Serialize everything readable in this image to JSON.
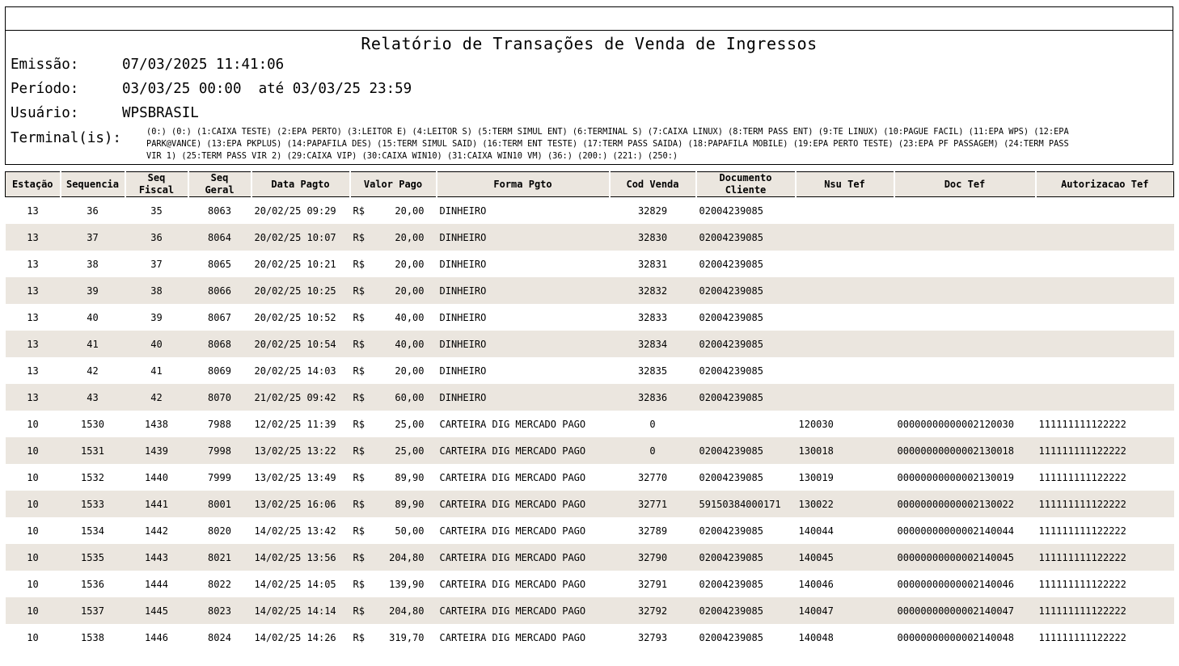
{
  "report": {
    "title": "Relatório de Transações de Venda de Ingressos",
    "emissao_label": "Emissão:",
    "emissao_value": "07/03/2025 11:41:06",
    "periodo_label": "Período:",
    "periodo_value": "03/03/25 00:00  até 03/03/25 23:59",
    "usuario_label": "Usuário:",
    "usuario_value": "WPSBRASIL",
    "terminais_label": "Terminal(is):",
    "terminais_value": "(0:) (0:) (1:CAIXA TESTE) (2:EPA PERTO) (3:LEITOR E) (4:LEITOR S) (5:TERM SIMUL ENT) (6:TERMINAL S) (7:CAIXA LINUX) (8:TERM PASS ENT) (9:TE LINUX) (10:PAGUE FACIL) (11:EPA WPS) (12:EPA PARK@VANCE) (13:EPA PKPLUS) (14:PAPAFILA DES) (15:TERM SIMUL SAID) (16:TERM ENT TESTE) (17:TERM PASS SAIDA) (18:PAPAFILA MOBILE) (19:EPA PERTO TESTE) (23:EPA PF PASSAGEM) (24:TERM PASS VIR 1) (25:TERM PASS VIR 2) (29:CAIXA VIP) (30:CAIXA WIN10) (31:CAIXA WIN10 VM) (36:) (200:) (221:) (250:)"
  },
  "table": {
    "headers": {
      "estacao": "Estação",
      "sequencia": "Sequencia",
      "seq_fiscal_1": "Seq",
      "seq_fiscal_2": "Fiscal",
      "seq_geral_1": "Seq",
      "seq_geral_2": "Geral",
      "data_pagto": "Data Pagto",
      "valor_pago": "Valor Pago",
      "forma_pgto": "Forma Pgto",
      "cod_venda": "Cod Venda",
      "documento_1": "Documento",
      "documento_2": "Cliente",
      "nsu_tef": "Nsu Tef",
      "doc_tef": "Doc Tef",
      "autorizacao_tef": "Autorizacao Tef"
    },
    "rows": [
      {
        "estacao": "13",
        "sequencia": "36",
        "seq_fiscal": "35",
        "seq_geral": "8063",
        "data": "20/02/25 09:29",
        "moeda": "R$",
        "valor": "20,00",
        "forma": "DINHEIRO",
        "cod_venda": "32829",
        "documento": "02004239085",
        "nsu": "",
        "doc_tef": "",
        "autorizacao": ""
      },
      {
        "estacao": "13",
        "sequencia": "37",
        "seq_fiscal": "36",
        "seq_geral": "8064",
        "data": "20/02/25 10:07",
        "moeda": "R$",
        "valor": "20,00",
        "forma": "DINHEIRO",
        "cod_venda": "32830",
        "documento": "02004239085",
        "nsu": "",
        "doc_tef": "",
        "autorizacao": ""
      },
      {
        "estacao": "13",
        "sequencia": "38",
        "seq_fiscal": "37",
        "seq_geral": "8065",
        "data": "20/02/25 10:21",
        "moeda": "R$",
        "valor": "20,00",
        "forma": "DINHEIRO",
        "cod_venda": "32831",
        "documento": "02004239085",
        "nsu": "",
        "doc_tef": "",
        "autorizacao": ""
      },
      {
        "estacao": "13",
        "sequencia": "39",
        "seq_fiscal": "38",
        "seq_geral": "8066",
        "data": "20/02/25 10:25",
        "moeda": "R$",
        "valor": "20,00",
        "forma": "DINHEIRO",
        "cod_venda": "32832",
        "documento": "02004239085",
        "nsu": "",
        "doc_tef": "",
        "autorizacao": ""
      },
      {
        "estacao": "13",
        "sequencia": "40",
        "seq_fiscal": "39",
        "seq_geral": "8067",
        "data": "20/02/25 10:52",
        "moeda": "R$",
        "valor": "40,00",
        "forma": "DINHEIRO",
        "cod_venda": "32833",
        "documento": "02004239085",
        "nsu": "",
        "doc_tef": "",
        "autorizacao": ""
      },
      {
        "estacao": "13",
        "sequencia": "41",
        "seq_fiscal": "40",
        "seq_geral": "8068",
        "data": "20/02/25 10:54",
        "moeda": "R$",
        "valor": "40,00",
        "forma": "DINHEIRO",
        "cod_venda": "32834",
        "documento": "02004239085",
        "nsu": "",
        "doc_tef": "",
        "autorizacao": ""
      },
      {
        "estacao": "13",
        "sequencia": "42",
        "seq_fiscal": "41",
        "seq_geral": "8069",
        "data": "20/02/25 14:03",
        "moeda": "R$",
        "valor": "20,00",
        "forma": "DINHEIRO",
        "cod_venda": "32835",
        "documento": "02004239085",
        "nsu": "",
        "doc_tef": "",
        "autorizacao": ""
      },
      {
        "estacao": "13",
        "sequencia": "43",
        "seq_fiscal": "42",
        "seq_geral": "8070",
        "data": "21/02/25 09:42",
        "moeda": "R$",
        "valor": "60,00",
        "forma": "DINHEIRO",
        "cod_venda": "32836",
        "documento": "02004239085",
        "nsu": "",
        "doc_tef": "",
        "autorizacao": ""
      },
      {
        "estacao": "10",
        "sequencia": "1530",
        "seq_fiscal": "1438",
        "seq_geral": "7988",
        "data": "12/02/25 11:39",
        "moeda": "R$",
        "valor": "25,00",
        "forma": "CARTEIRA DIG MERCADO PAGO",
        "cod_venda": "0",
        "documento": "",
        "nsu": "120030",
        "doc_tef": "00000000000002120030",
        "autorizacao": "111111111122222"
      },
      {
        "estacao": "10",
        "sequencia": "1531",
        "seq_fiscal": "1439",
        "seq_geral": "7998",
        "data": "13/02/25 13:22",
        "moeda": "R$",
        "valor": "25,00",
        "forma": "CARTEIRA DIG MERCADO PAGO",
        "cod_venda": "0",
        "documento": "02004239085",
        "nsu": "130018",
        "doc_tef": "00000000000002130018",
        "autorizacao": "111111111122222"
      },
      {
        "estacao": "10",
        "sequencia": "1532",
        "seq_fiscal": "1440",
        "seq_geral": "7999",
        "data": "13/02/25 13:49",
        "moeda": "R$",
        "valor": "89,90",
        "forma": "CARTEIRA DIG MERCADO PAGO",
        "cod_venda": "32770",
        "documento": "02004239085",
        "nsu": "130019",
        "doc_tef": "00000000000002130019",
        "autorizacao": "111111111122222"
      },
      {
        "estacao": "10",
        "sequencia": "1533",
        "seq_fiscal": "1441",
        "seq_geral": "8001",
        "data": "13/02/25 16:06",
        "moeda": "R$",
        "valor": "89,90",
        "forma": "CARTEIRA DIG MERCADO PAGO",
        "cod_venda": "32771",
        "documento": "59150384000171",
        "nsu": "130022",
        "doc_tef": "00000000000002130022",
        "autorizacao": "111111111122222"
      },
      {
        "estacao": "10",
        "sequencia": "1534",
        "seq_fiscal": "1442",
        "seq_geral": "8020",
        "data": "14/02/25 13:42",
        "moeda": "R$",
        "valor": "50,00",
        "forma": "CARTEIRA DIG MERCADO PAGO",
        "cod_venda": "32789",
        "documento": "02004239085",
        "nsu": "140044",
        "doc_tef": "00000000000002140044",
        "autorizacao": "111111111122222"
      },
      {
        "estacao": "10",
        "sequencia": "1535",
        "seq_fiscal": "1443",
        "seq_geral": "8021",
        "data": "14/02/25 13:56",
        "moeda": "R$",
        "valor": "204,80",
        "forma": "CARTEIRA DIG MERCADO PAGO",
        "cod_venda": "32790",
        "documento": "02004239085",
        "nsu": "140045",
        "doc_tef": "00000000000002140045",
        "autorizacao": "111111111122222"
      },
      {
        "estacao": "10",
        "sequencia": "1536",
        "seq_fiscal": "1444",
        "seq_geral": "8022",
        "data": "14/02/25 14:05",
        "moeda": "R$",
        "valor": "139,90",
        "forma": "CARTEIRA DIG MERCADO PAGO",
        "cod_venda": "32791",
        "documento": "02004239085",
        "nsu": "140046",
        "doc_tef": "00000000000002140046",
        "autorizacao": "111111111122222"
      },
      {
        "estacao": "10",
        "sequencia": "1537",
        "seq_fiscal": "1445",
        "seq_geral": "8023",
        "data": "14/02/25 14:14",
        "moeda": "R$",
        "valor": "204,80",
        "forma": "CARTEIRA DIG MERCADO PAGO",
        "cod_venda": "32792",
        "documento": "02004239085",
        "nsu": "140047",
        "doc_tef": "00000000000002140047",
        "autorizacao": "111111111122222"
      },
      {
        "estacao": "10",
        "sequencia": "1538",
        "seq_fiscal": "1446",
        "seq_geral": "8024",
        "data": "14/02/25 14:26",
        "moeda": "R$",
        "valor": "319,70",
        "forma": "CARTEIRA DIG MERCADO PAGO",
        "cod_venda": "32793",
        "documento": "02004239085",
        "nsu": "140048",
        "doc_tef": "00000000000002140048",
        "autorizacao": "111111111122222"
      }
    ]
  }
}
